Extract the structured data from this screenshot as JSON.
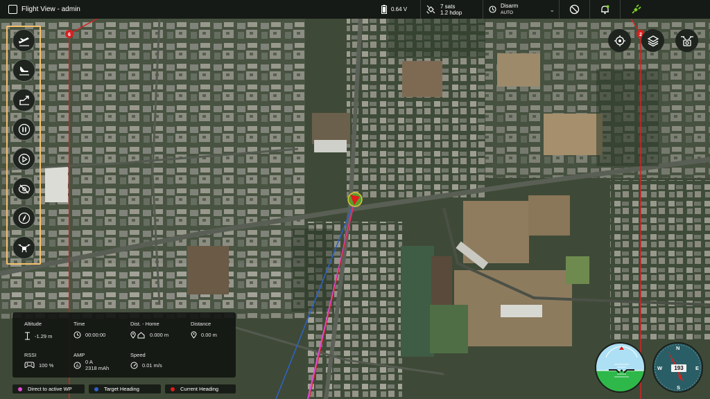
{
  "window": {
    "title": "Flight View - admin"
  },
  "status": {
    "battery": "0.64 V",
    "gps_sats": "7 sats",
    "gps_hdop": "1.2 hdop",
    "arm_state": "Disarm",
    "flight_mode": "AUTO"
  },
  "tools": [
    {
      "name": "takeoff"
    },
    {
      "name": "land"
    },
    {
      "name": "return-home"
    },
    {
      "name": "pause"
    },
    {
      "name": "play"
    },
    {
      "name": "disable"
    },
    {
      "name": "compass"
    },
    {
      "name": "drone"
    }
  ],
  "map": {
    "waypoints": [
      {
        "label": "6"
      },
      {
        "label": "2"
      }
    ]
  },
  "telemetry": {
    "altitude_label": "Altitude",
    "altitude_value": "-1.29 m",
    "time_label": "Time",
    "time_value": "00:00:00",
    "dist_home_label": "Dist. - Home",
    "dist_home_value": "0.000 m",
    "distance_label": "Distance",
    "distance_value": "0.00 m",
    "rssi_label": "RSSI",
    "rssi_value": "100 %",
    "amp_label": "AMP",
    "amp_value": "0 A",
    "amp_capacity": "2318 mAh",
    "speed_label": "Speed",
    "speed_value": "0.01 m/s"
  },
  "legend": [
    {
      "label": "Direct to active WP",
      "color": "#e04bd6"
    },
    {
      "label": "Target Heading",
      "color": "#2f62c9"
    },
    {
      "label": "Current Heading",
      "color": "#e01c1c"
    }
  ],
  "compass": {
    "heading": "193",
    "north": "N",
    "east": "E",
    "south": "S",
    "west": "W"
  },
  "colors": {
    "accent_outline": "#f5c16c",
    "connected": "#7ed321",
    "panel_bg": "#121612"
  }
}
